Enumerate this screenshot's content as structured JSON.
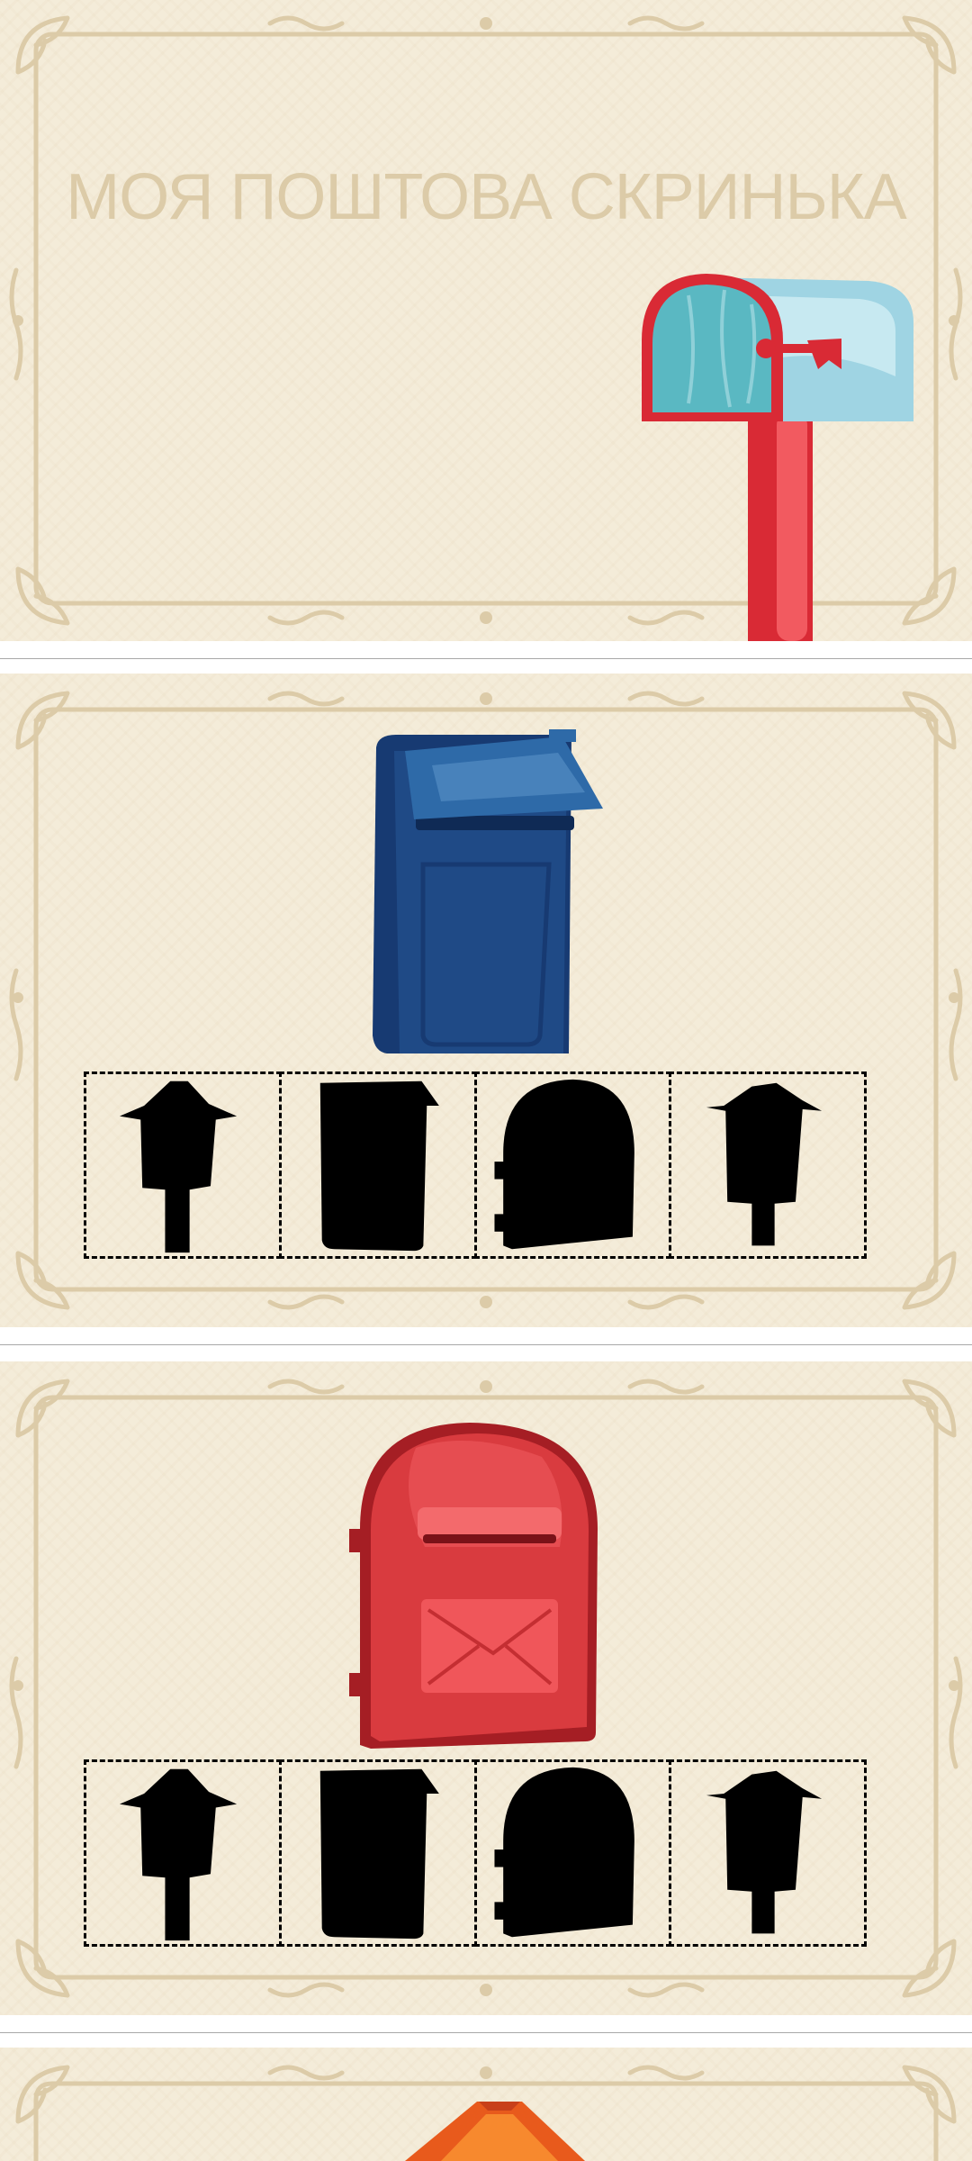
{
  "cover": {
    "title": "МОЯ ПОШТОВА СКРИНЬКА"
  },
  "puzzles": [
    {
      "target": "blue-wall-mailbox",
      "options": [
        "post-mailbox",
        "wall-mailbox",
        "arched-mailbox",
        "pole-mailbox"
      ]
    },
    {
      "target": "red-arched-mailbox",
      "options": [
        "post-mailbox",
        "wall-mailbox",
        "arched-mailbox",
        "pole-mailbox"
      ]
    },
    {
      "target": "orange-house-mailbox",
      "options": []
    }
  ],
  "colors": {
    "background": "#f4ecd9",
    "ornament": "#dccba8",
    "title": "#dccba8",
    "silhouette": "#000000",
    "blue_mailbox": "#1f4a86",
    "red_mailbox": "#d93b3f",
    "teal_mailbox": "#9ed3e0",
    "orange_mailbox": "#e85a1c"
  }
}
